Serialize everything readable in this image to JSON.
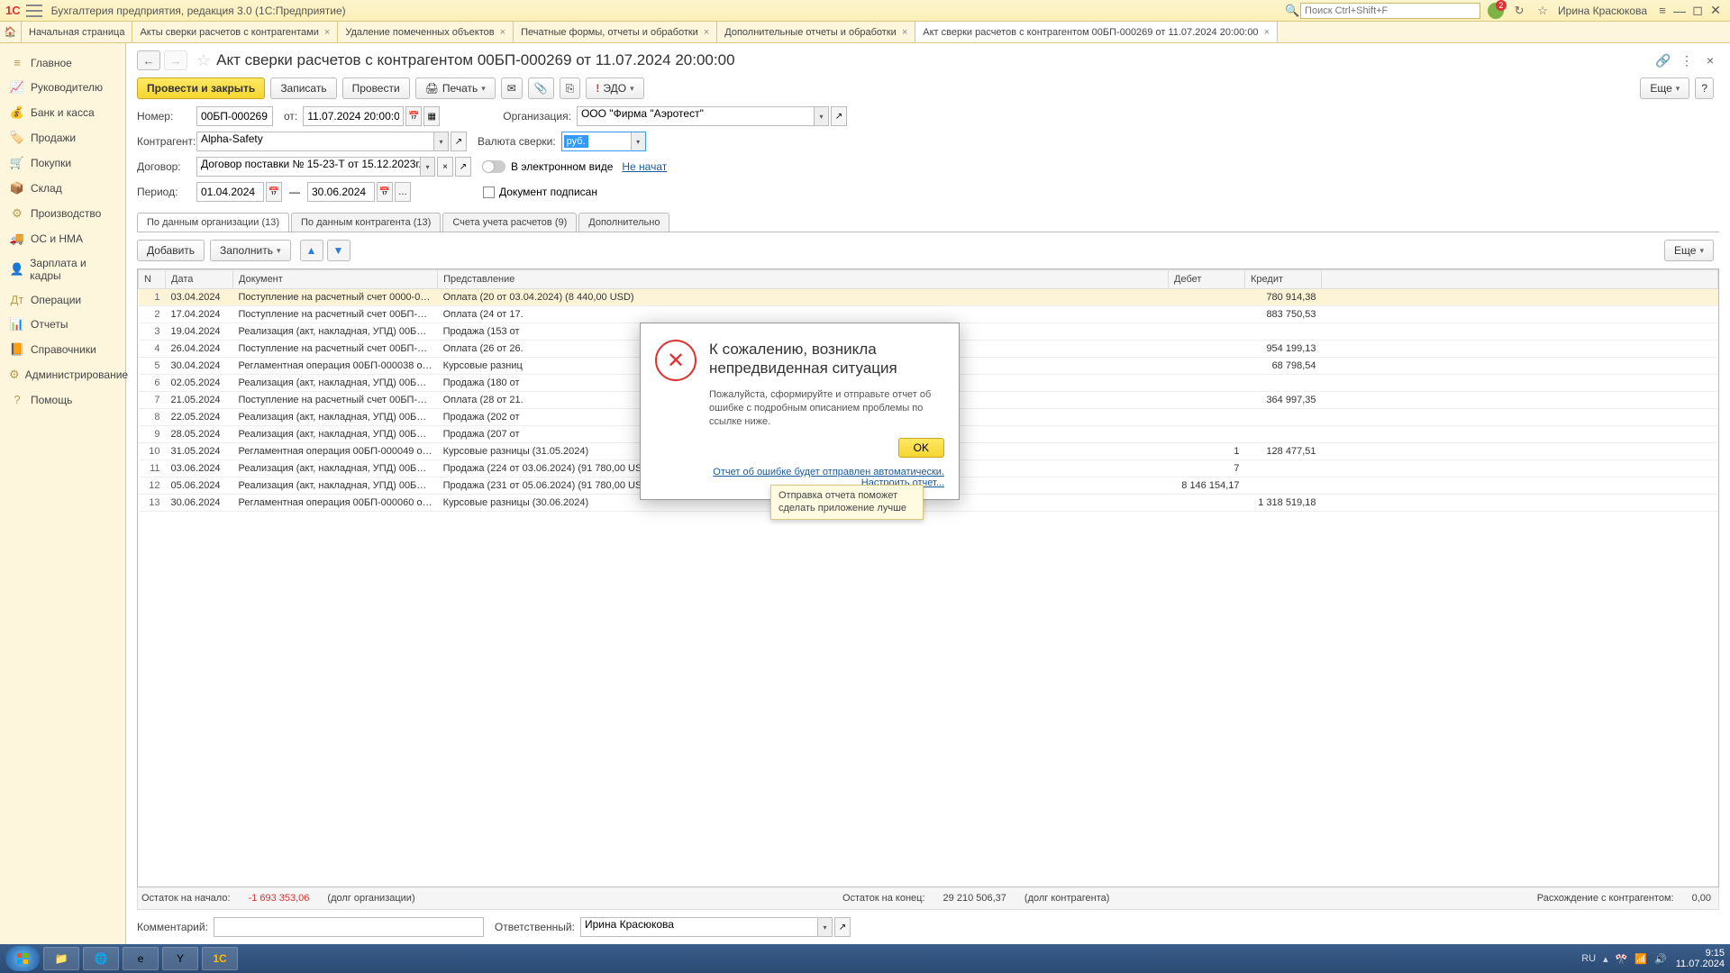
{
  "titlebar": {
    "app_title": "Бухгалтерия предприятия, редакция 3.0  (1С:Предприятие)",
    "search_placeholder": "Поиск Ctrl+Shift+F",
    "user": "Ирина Красюкова"
  },
  "tabs": {
    "home": "Начальная страница",
    "items": [
      "Акты сверки расчетов с контрагентами",
      "Удаление помеченных объектов",
      "Печатные формы, отчеты и обработки",
      "Дополнительные отчеты и обработки",
      "Акт сверки расчетов с контрагентом 00БП-000269 от 11.07.2024 20:00:00"
    ]
  },
  "sidebar": [
    "Главное",
    "Руководителю",
    "Банк и касса",
    "Продажи",
    "Покупки",
    "Склад",
    "Производство",
    "ОС и НМА",
    "Зарплата и кадры",
    "Операции",
    "Отчеты",
    "Справочники",
    "Администрирование",
    "Помощь"
  ],
  "doc": {
    "title": "Акт сверки расчетов с контрагентом 00БП-000269 от 11.07.2024 20:00:00",
    "btn_post_close": "Провести и закрыть",
    "btn_record": "Записать",
    "btn_post": "Провести",
    "btn_print": "Печать",
    "btn_edo": "ЭДО",
    "btn_more": "Еще",
    "lbl_number": "Номер:",
    "number": "00БП-000269",
    "lbl_from": "от:",
    "date": "11.07.2024 20:00:00",
    "lbl_org": "Организация:",
    "org": "ООО \"Фирма \"Аэротест\"",
    "lbl_contr": "Контрагент:",
    "contr": "Alpha-Safety",
    "lbl_currency": "Валюта сверки:",
    "currency": "руб.",
    "lbl_contract": "Договор:",
    "contract": "Договор поставки № 15-23-Т от 15.12.2023г.",
    "lbl_electronic": "В электронном виде",
    "link_notstarted": "Не начат",
    "lbl_period": "Период:",
    "period_from": "01.04.2024",
    "period_to": "30.06.2024",
    "period_dash": "—",
    "chk_signed": "Документ подписан",
    "inner_tabs": [
      "По данным организации (13)",
      "По данным контрагента (13)",
      "Счета учета расчетов (9)",
      "Дополнительно"
    ],
    "btn_add": "Добавить",
    "btn_fill": "Заполнить",
    "cols": [
      "N",
      "Дата",
      "Документ",
      "Представление",
      "Дебет",
      "Кредит"
    ],
    "rows": [
      {
        "n": 1,
        "d": "03.04.2024",
        "doc": "Поступление на расчетный счет 0000-0…",
        "rep": "Оплата (20 от 03.04.2024) (8 440,00 USD)",
        "deb": "",
        "cred": "780 914,38"
      },
      {
        "n": 2,
        "d": "17.04.2024",
        "doc": "Поступление на расчетный счет 00БП-…",
        "rep": "Оплата (24 от 17.",
        "deb": "",
        "cred": "883 750,53"
      },
      {
        "n": 3,
        "d": "19.04.2024",
        "doc": "Реализация (акт, накладная, УПД) 00Б…",
        "rep": "Продажа (153 от",
        "deb": "",
        "cred": ""
      },
      {
        "n": 4,
        "d": "26.04.2024",
        "doc": "Поступление на расчетный счет 00БП-…",
        "rep": "Оплата (26 от 26.",
        "deb": "",
        "cred": "954 199,13"
      },
      {
        "n": 5,
        "d": "30.04.2024",
        "doc": "Регламентная операция 00БП-000038 о…",
        "rep": "Курсовые разниц",
        "deb": "",
        "cred": "68 798,54"
      },
      {
        "n": 6,
        "d": "02.05.2024",
        "doc": "Реализация (акт, накладная, УПД) 00Б…",
        "rep": "Продажа (180 от",
        "deb": "",
        "cred": ""
      },
      {
        "n": 7,
        "d": "21.05.2024",
        "doc": "Поступление на расчетный счет 00БП-…",
        "rep": "Оплата (28 от 21.",
        "deb": "",
        "cred": "364 997,35"
      },
      {
        "n": 8,
        "d": "22.05.2024",
        "doc": "Реализация (акт, накладная, УПД) 00Б…",
        "rep": "Продажа (202 от",
        "deb": "",
        "cred": ""
      },
      {
        "n": 9,
        "d": "28.05.2024",
        "doc": "Реализация (акт, накладная, УПД) 00Б…",
        "rep": "Продажа (207 от",
        "deb": "",
        "cred": ""
      },
      {
        "n": 10,
        "d": "31.05.2024",
        "doc": "Регламентная операция 00БП-000049 о…",
        "rep": "Курсовые разницы (31.05.2024)",
        "deb": "1",
        "cred": "128 477,51"
      },
      {
        "n": 11,
        "d": "03.06.2024",
        "doc": "Реализация (акт, накладная, УПД) 00Б…",
        "rep": "Продажа (224 от 03.06.2024) (91 780,00 USD)",
        "deb": "7",
        "cred": ""
      },
      {
        "n": 12,
        "d": "05.06.2024",
        "doc": "Реализация (акт, накладная, УПД) 00Б…",
        "rep": "Продажа (231 от 05.06.2024) (91 780,00 USD)",
        "deb": "8 146 154,17",
        "cred": ""
      },
      {
        "n": 13,
        "d": "30.06.2024",
        "doc": "Регламентная операция 00БП-000060 о…",
        "rep": "Курсовые разницы (30.06.2024)",
        "deb": "",
        "cred": "1 318 519,18"
      }
    ],
    "footer": {
      "start_lbl": "Остаток на начало:",
      "start_val": "-1 693 353,06",
      "start_note": "(долг организации)",
      "end_lbl": "Остаток на конец:",
      "end_val": "29 210 506,37",
      "end_note": "(долг контрагента)",
      "diff_lbl": "Расхождение с контрагентом:",
      "diff_val": "0,00"
    },
    "lbl_comment": "Комментарий:",
    "lbl_resp": "Ответственный:",
    "resp": "Ирина Красюкова"
  },
  "modal": {
    "title": "К сожалению, возникла непредвиденная ситуация",
    "text": "Пожалуйста, сформируйте и отправьте отчет об ошибке с подробным описанием проблемы по ссылке ниже.",
    "ok": "OK",
    "link1": "Отчет об ошибке будет отправлен автоматически.",
    "link2": "Настроить отчет...",
    "tooltip": "Отправка отчета поможет сделать приложение лучше"
  },
  "taskbar": {
    "lang": "RU",
    "time": "9:15",
    "date": "11.07.2024"
  }
}
